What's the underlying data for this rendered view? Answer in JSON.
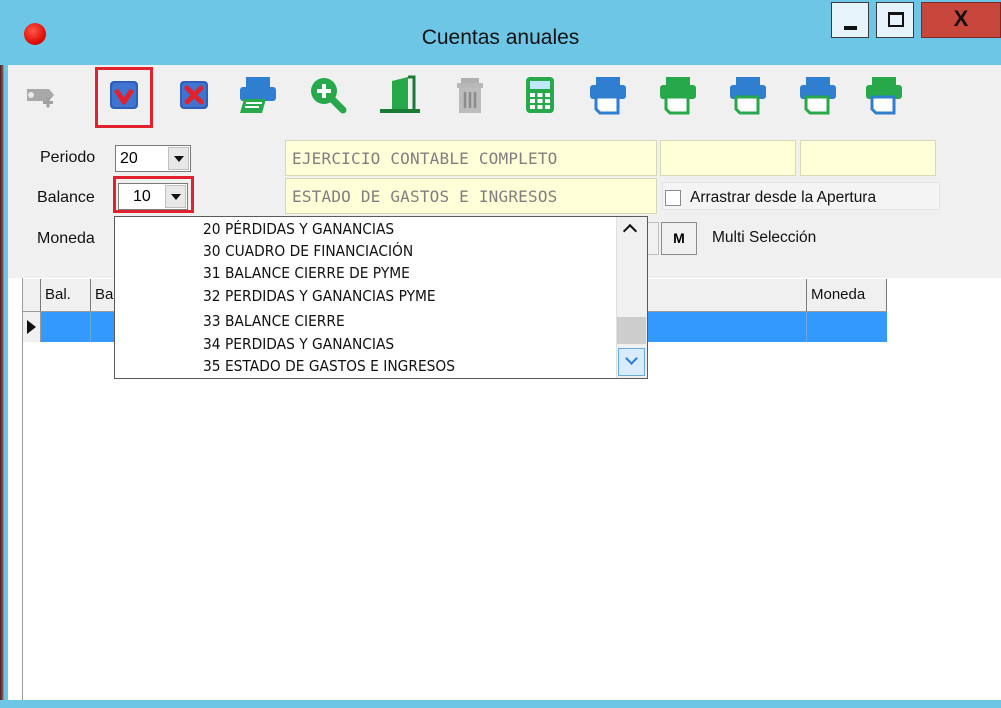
{
  "window": {
    "title": "Cuentas anuales",
    "close_label": "X"
  },
  "toolbar": {
    "icons": [
      "add-icon",
      "accept-icon",
      "cancel-icon",
      "print-preview-icon",
      "search-icon",
      "exit-door-icon",
      "delete-icon",
      "calculator-icon",
      "print-icon",
      "print-icon",
      "print-icon",
      "print-icon",
      "print-icon"
    ]
  },
  "form": {
    "periodo_label": "Periodo",
    "periodo_value": "20",
    "balance_label": "Balance",
    "balance_value": "10",
    "moneda_label": "Moneda",
    "ejercicio_text": "EJERCICIO CONTABLE COMPLETO",
    "estado_text": "ESTADO DE GASTOS E INGRESOS",
    "arrastrar_label": "Arrastrar desde la Apertura",
    "multi_button": "M",
    "multi_label": "Multi Selección"
  },
  "grid": {
    "columns": [
      "Bal.",
      "Ba",
      "Moneda"
    ]
  },
  "dropdown": {
    "items": [
      "20 PÉRDIDAS Y GANANCIAS",
      "30 CUADRO DE FINANCIACIÓN",
      "31 BALANCE CIERRE DE PYME",
      "32 PERDIDAS Y GANANCIAS PYME",
      "33 BALANCE CIERRE",
      "34 PERDIDAS Y GANANCIAS",
      "35 ESTADO DE GASTOS E INGRESOS"
    ]
  },
  "colors": {
    "title_bar": "#6ec6e6",
    "selection": "#3399ff",
    "highlight_border": "#e0212e",
    "readonly_field": "#ffffd8"
  }
}
